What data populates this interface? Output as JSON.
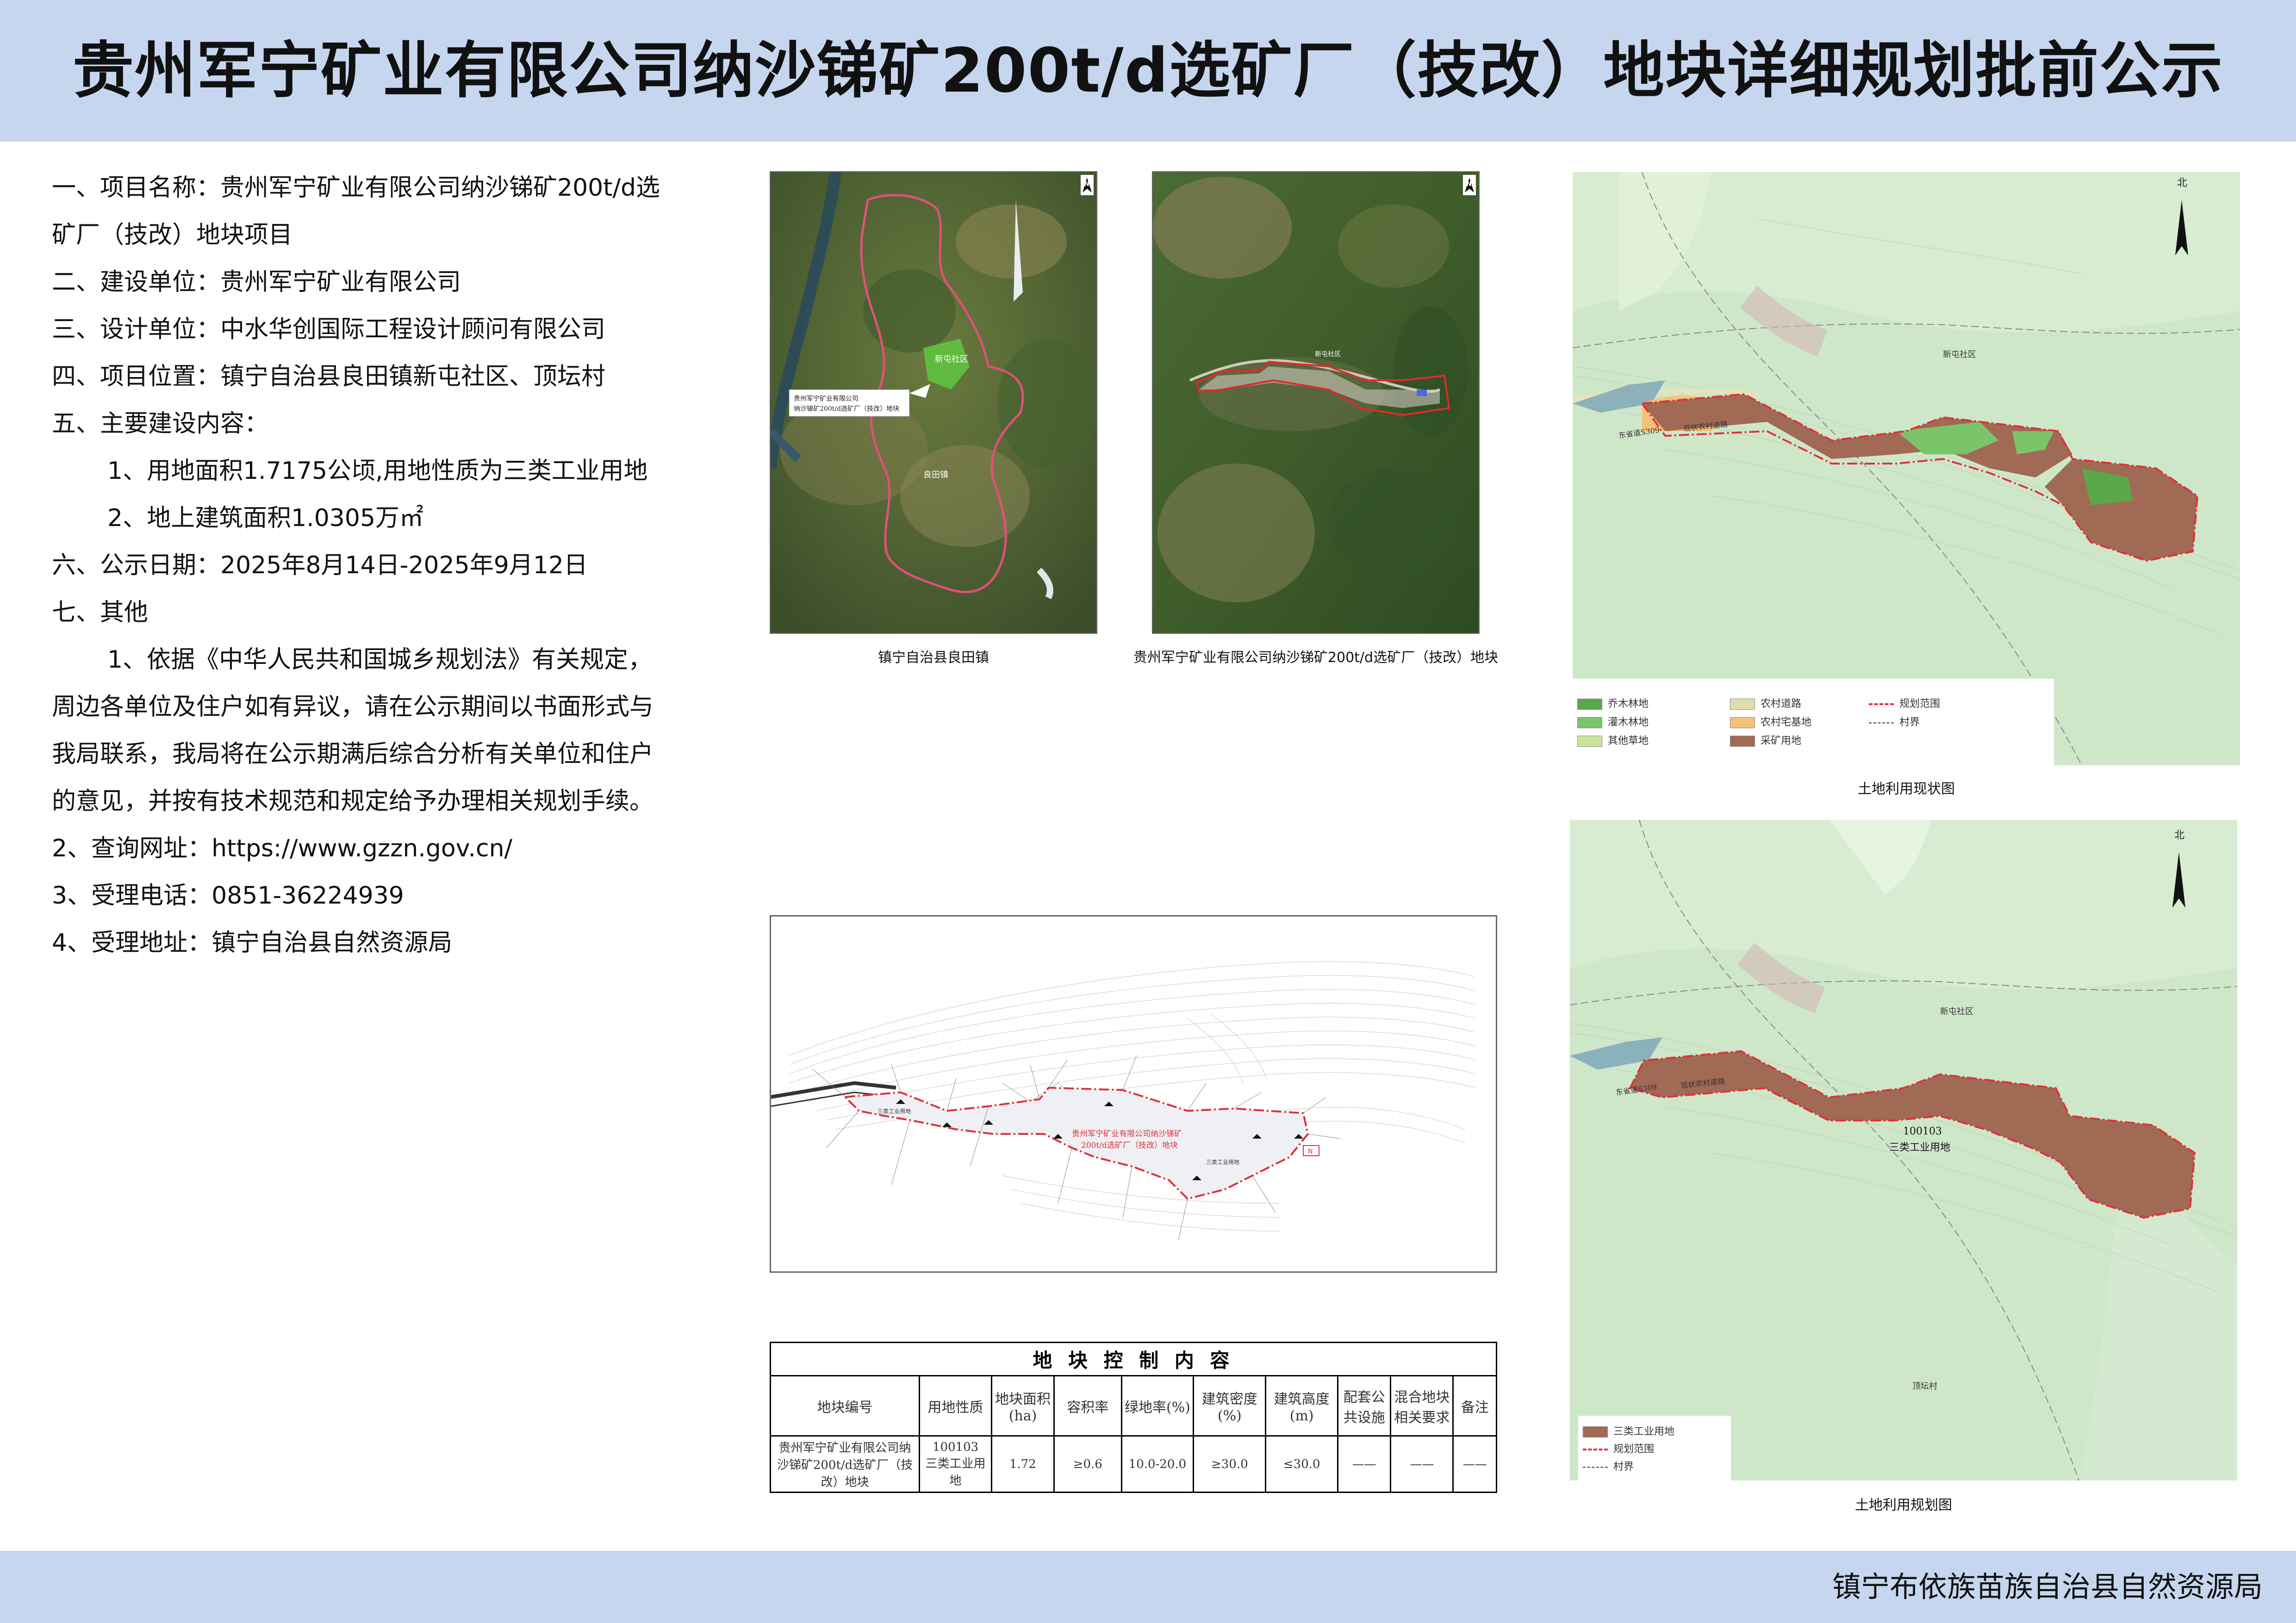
{
  "header": {
    "title": "贵州军宁矿业有限公司纳沙锑矿200t/d选矿厂（技改）地块详细规划批前公示"
  },
  "info": {
    "item1": "一、项目名称：贵州军宁矿业有限公司纳沙锑矿200t/d选",
    "item1b": "矿厂（技改）地块项目",
    "item2": "二、建设单位：贵州军宁矿业有限公司",
    "item3": "三、设计单位：中水华创国际工程设计顾问有限公司",
    "item4": "四、项目位置：镇宁自治县良田镇新屯社区、顶坛村",
    "item5": "五、主要建设内容：",
    "item5a": "1、用地面积1.7175公顷,用地性质为三类工业用地",
    "item5b": "2、地上建筑面积1.0305万㎡",
    "item6": "六、公示日期：2025年8月14日-2025年9月12日",
    "item7": "七、其他",
    "item7p1": "1、依据《中华人民共和国城乡规划法》有关规定，",
    "item7p2": "周边各单位及住户如有异议，请在公示期间以书面形式与",
    "item7p3": "我局联系，我局将在公示期满后综合分析有关单位和住户",
    "item7p4": "的意见，并按有技术规范和规定给予办理相关规划手续。",
    "item7b": "2、查询网址：https://www.gzzn.gov.cn/",
    "item7c": "3、受理电话：0851-36224939",
    "item7d": "4、受理地址：镇宁自治县自然资源局"
  },
  "maps": {
    "sat1_caption": "镇宁自治县良田镇",
    "sat1_label_a": "新屯社区",
    "sat1_label_b": "良田镇",
    "sat1_callout_1": "贵州军宁矿业有限公司",
    "sat1_callout_2": "纳沙锑矿200t/d选矿厂（技改）地块",
    "sat2_caption": "贵州军宁矿业有限公司纳沙锑矿200t/d选矿厂（技改）地块",
    "sat2_label": "新屯社区",
    "north": "N",
    "survey_label_1": "贵州军宁矿业有限公司纳沙锑矿",
    "survey_label_2": "200t/d选矿厂（技改）地块",
    "survey_plot": "三类工业用地",
    "current_caption": "土地利用现状图",
    "plan_caption": "土地利用规划图",
    "north_cn": "北",
    "map_xintun": "新屯社区",
    "map_road_1": "东省道S309",
    "map_road_2": "现状农村道路",
    "map_dingtan": "顶坛村",
    "plan_plot_id": "100103",
    "plan_plot_use": "三类工业用地"
  },
  "legend_current": [
    {
      "label": "乔木林地",
      "color": "#5aa84a"
    },
    {
      "label": "灌木林地",
      "color": "#7cc46a"
    },
    {
      "label": "其他草地",
      "color": "#c6e59a"
    },
    {
      "label": "农村道路",
      "color": "#e0dcae"
    },
    {
      "label": "农村宅基地",
      "color": "#f5c27a"
    },
    {
      "label": "采矿用地",
      "color": "#a06a55"
    },
    {
      "label": "规划范围",
      "color": "#e0303a"
    },
    {
      "label": "村界",
      "color": "#777777"
    }
  ],
  "legend_plan": [
    {
      "label": "三类工业用地",
      "color": "#a06a55"
    },
    {
      "label": "规划范围",
      "color": "#e0303a"
    },
    {
      "label": "村界",
      "color": "#777777"
    }
  ],
  "table": {
    "title": "地 块 控 制 内 容",
    "headers": [
      "地块编号",
      "用地性质",
      "地块面积(ha)",
      "容积率",
      "绿地率(%)",
      "建筑密度(%)",
      "建筑高度(m)",
      "配套公共设施",
      "混合地块相关要求",
      "备注"
    ],
    "row_name": "贵州军宁矿业有限公司纳沙锑矿200t/d选矿厂（技改）地块",
    "row_use_id": "100103",
    "row_use": "三类工业用地",
    "row_area": "1.72",
    "row_far": "≥0.6",
    "row_green": "10.0-20.0",
    "row_density": "≥30.0",
    "row_height": "≤30.0",
    "row_public": "——",
    "row_mixed": "——",
    "row_note": "——"
  },
  "footer": {
    "org": "镇宁布依族苗族自治县自然资源局"
  }
}
